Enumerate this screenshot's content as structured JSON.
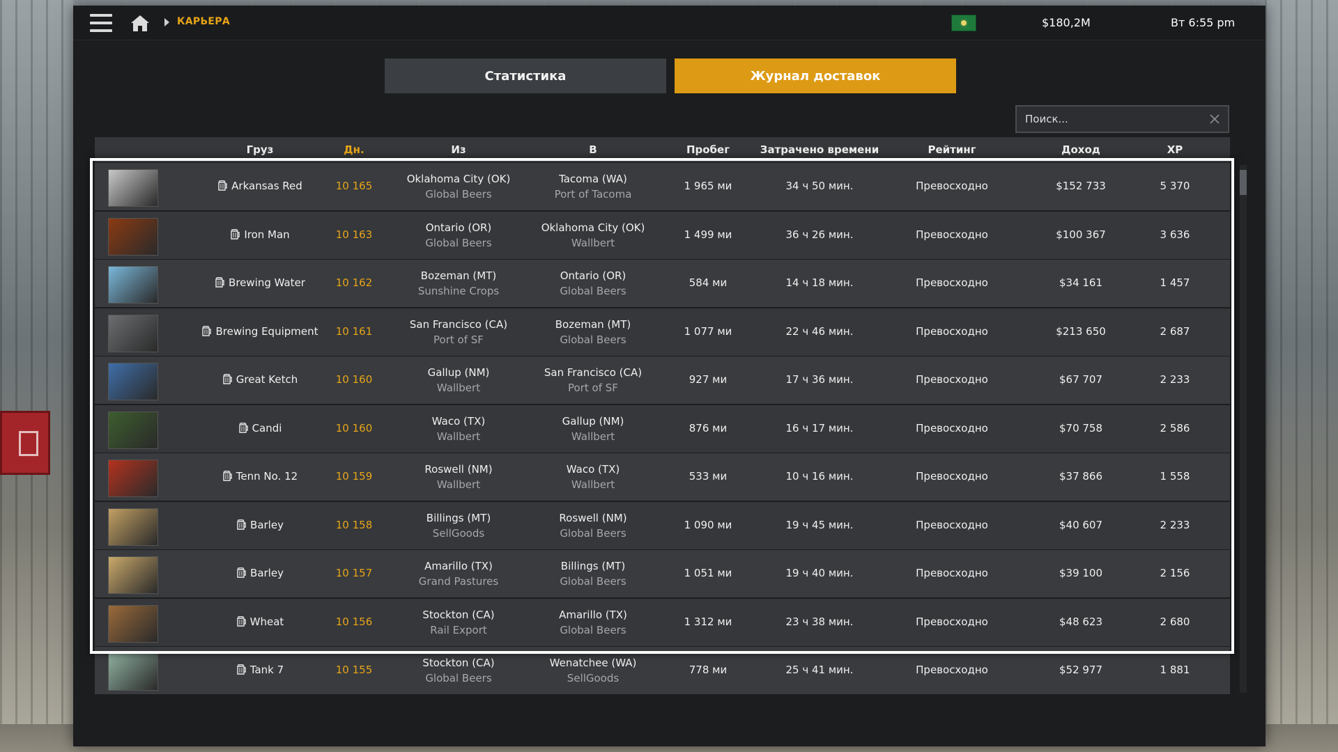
{
  "topbar": {
    "breadcrumb": "КАРЬЕРА",
    "money": "$180,2M",
    "clock": "Вт 6:55 pm"
  },
  "tabs": {
    "stats": "Статистика",
    "log": "Журнал доставок"
  },
  "search": {
    "placeholder": "Поиск..."
  },
  "columns": {
    "cargo": "Груз",
    "day": "Дн.",
    "from": "Из",
    "to": "В",
    "distance": "Пробег",
    "time": "Затрачено времени",
    "rating": "Рейтинг",
    "income": "Доход",
    "xp": "XP"
  },
  "rows": [
    {
      "cargo": "Arkansas Red",
      "day": "10 165",
      "from_city": "Oklahoma City (OK)",
      "from_company": "Global Beers",
      "to_city": "Tacoma (WA)",
      "to_company": "Port of Tacoma",
      "distance": "1 965 ми",
      "time": "34 ч 50 мин.",
      "rating": "Превосходно",
      "income": "$152 733",
      "xp": "5 370"
    },
    {
      "cargo": "Iron Man",
      "day": "10 163",
      "from_city": "Ontario (OR)",
      "from_company": "Global Beers",
      "to_city": "Oklahoma City (OK)",
      "to_company": "Wallbert",
      "distance": "1 499 ми",
      "time": "36 ч 26 мин.",
      "rating": "Превосходно",
      "income": "$100 367",
      "xp": "3 636"
    },
    {
      "cargo": "Brewing Water",
      "day": "10 162",
      "from_city": "Bozeman (MT)",
      "from_company": "Sunshine Crops",
      "to_city": "Ontario (OR)",
      "to_company": "Global Beers",
      "distance": "584 ми",
      "time": "14 ч 18 мин.",
      "rating": "Превосходно",
      "income": "$34 161",
      "xp": "1 457"
    },
    {
      "cargo": "Brewing Equipment",
      "day": "10 161",
      "from_city": "San Francisco (CA)",
      "from_company": "Port of SF",
      "to_city": "Bozeman (MT)",
      "to_company": "Global Beers",
      "distance": "1 077 ми",
      "time": "22 ч 46 мин.",
      "rating": "Превосходно",
      "income": "$213 650",
      "xp": "2 687"
    },
    {
      "cargo": "Great Ketch",
      "day": "10 160",
      "from_city": "Gallup (NM)",
      "from_company": "Wallbert",
      "to_city": "San Francisco (CA)",
      "to_company": "Port of SF",
      "distance": "927 ми",
      "time": "17 ч 36 мин.",
      "rating": "Превосходно",
      "income": "$67 707",
      "xp": "2 233"
    },
    {
      "cargo": "Candi",
      "day": "10 160",
      "from_city": "Waco (TX)",
      "from_company": "Wallbert",
      "to_city": "Gallup (NM)",
      "to_company": "Wallbert",
      "distance": "876 ми",
      "time": "16 ч 17 мин.",
      "rating": "Превосходно",
      "income": "$70 758",
      "xp": "2 586"
    },
    {
      "cargo": "Tenn No. 12",
      "day": "10 159",
      "from_city": "Roswell (NM)",
      "from_company": "Wallbert",
      "to_city": "Waco (TX)",
      "to_company": "Wallbert",
      "distance": "533 ми",
      "time": "10 ч 16 мин.",
      "rating": "Превосходно",
      "income": "$37 866",
      "xp": "1 558"
    },
    {
      "cargo": "Barley",
      "day": "10 158",
      "from_city": "Billings (MT)",
      "from_company": "SellGoods",
      "to_city": "Roswell (NM)",
      "to_company": "Global Beers",
      "distance": "1 090 ми",
      "time": "19 ч 45 мин.",
      "rating": "Превосходно",
      "income": "$40 607",
      "xp": "2 233"
    },
    {
      "cargo": "Barley",
      "day": "10 157",
      "from_city": "Amarillo (TX)",
      "from_company": "Grand Pastures",
      "to_city": "Billings (MT)",
      "to_company": "Global Beers",
      "distance": "1 051 ми",
      "time": "19 ч 40 мин.",
      "rating": "Превосходно",
      "income": "$39 100",
      "xp": "2 156"
    },
    {
      "cargo": "Wheat",
      "day": "10 156",
      "from_city": "Stockton (CA)",
      "from_company": "Rail Export",
      "to_city": "Amarillo (TX)",
      "to_company": "Global Beers",
      "distance": "1 312 ми",
      "time": "23 ч 38 мин.",
      "rating": "Превосходно",
      "income": "$48 623",
      "xp": "2 680"
    },
    {
      "cargo": "Tank 7",
      "day": "10 155",
      "from_city": "Stockton (CA)",
      "from_company": "Global Beers",
      "to_city": "Wenatchee (WA)",
      "to_company": "SellGoods",
      "distance": "778 ми",
      "time": "25 ч 41 мин.",
      "rating": "Превосходно",
      "income": "$52 977",
      "xp": "1 881"
    }
  ],
  "thumb_colors": [
    "#c8c8c8",
    "#8a3a12",
    "#7ab7d9",
    "#6b6e70",
    "#3f6ea8",
    "#3d5d2e",
    "#b3321e",
    "#c2a063",
    "#c9a96a",
    "#9a6a3a",
    "#8fb0a0"
  ]
}
